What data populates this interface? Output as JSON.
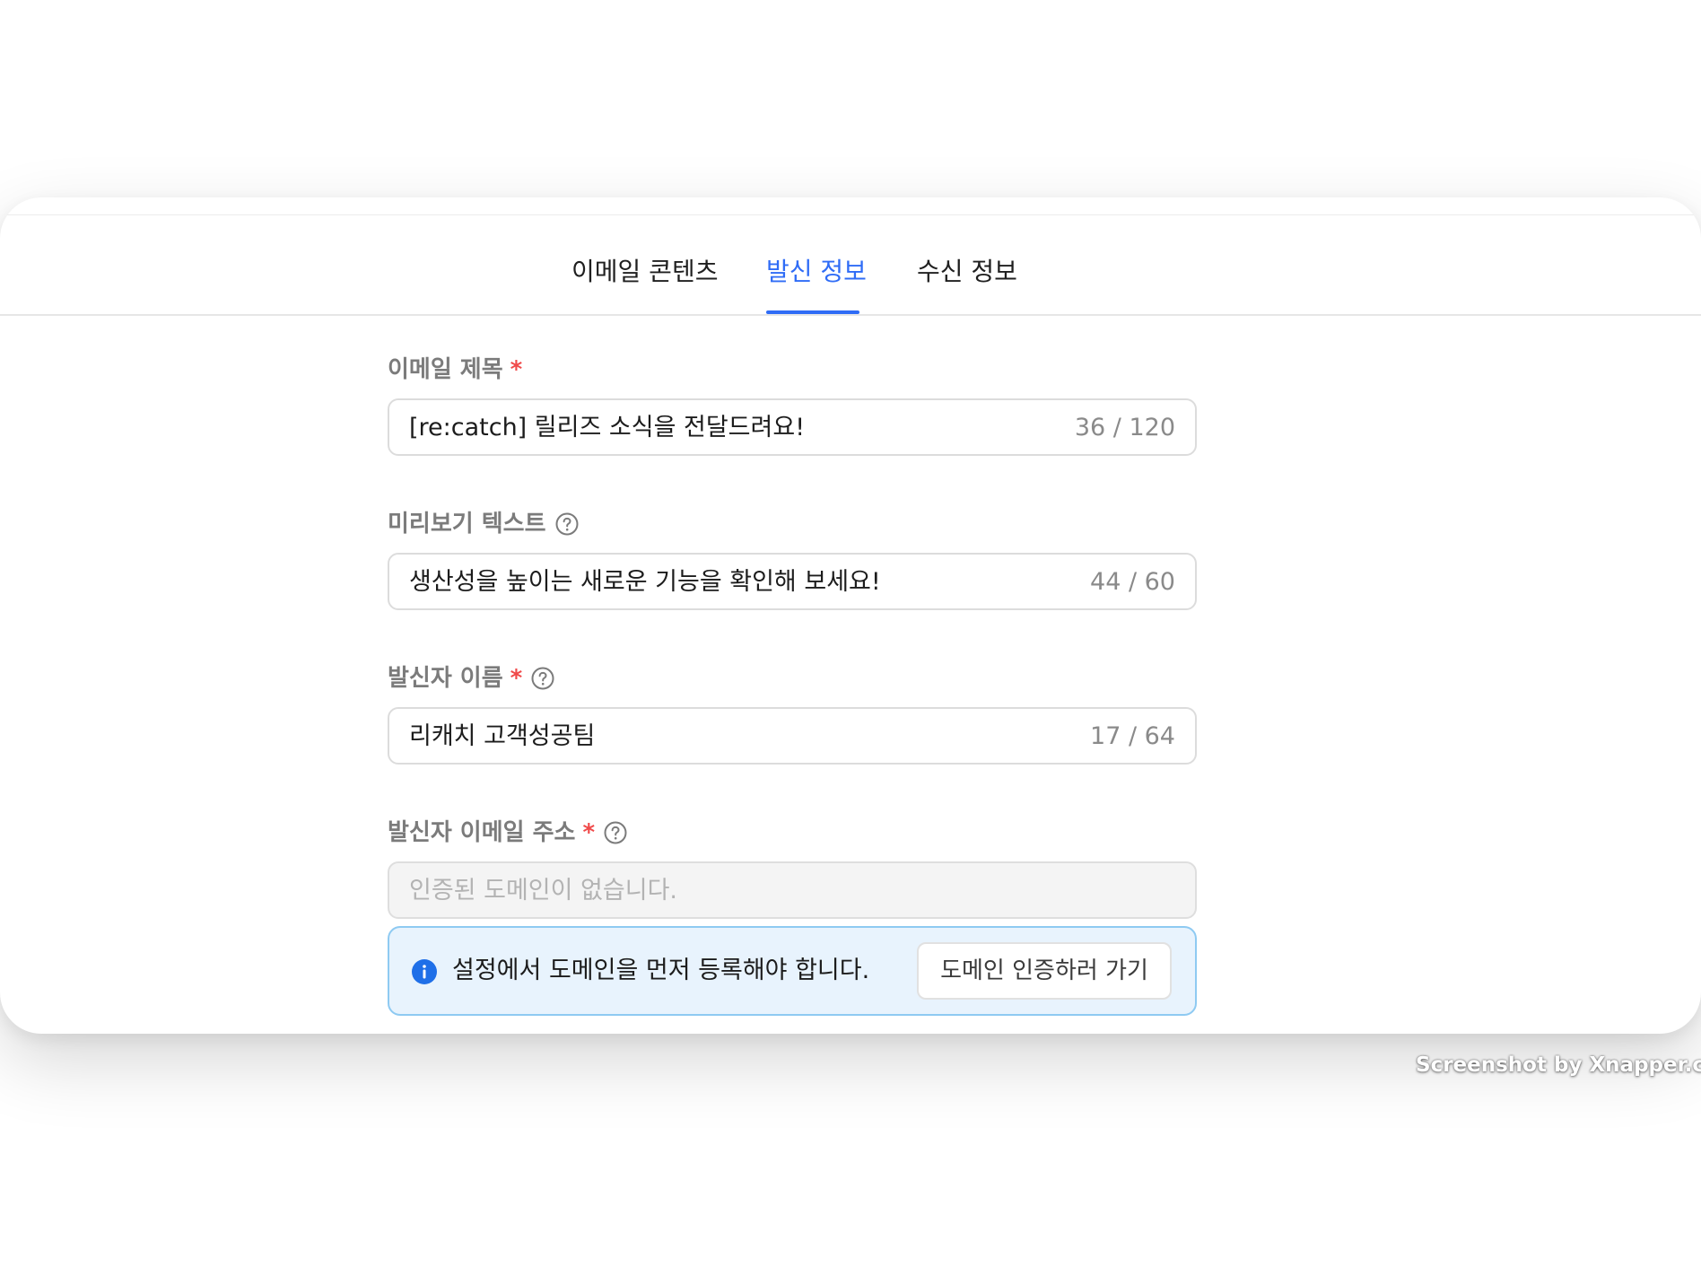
{
  "tabs": [
    {
      "label": "이메일 콘텐츠"
    },
    {
      "label": "발신 정보"
    },
    {
      "label": "수신 정보"
    }
  ],
  "active_tab": "발신 정보",
  "accent_color": "#2f6cf6",
  "required_color": "#f04a4a",
  "form": {
    "subject": {
      "label": "이메일 제목",
      "required_mark": "*",
      "value": "[re:catch] 릴리즈 소식을 전달드려요!",
      "counter": "36 / 120"
    },
    "preview": {
      "label": "미리보기 텍스트",
      "value": "생산성을 높이는 새로운 기능을 확인해 보세요!",
      "counter": "44 / 60"
    },
    "sender_name": {
      "label": "발신자 이름",
      "required_mark": "*",
      "value": "리캐치 고객성공팀",
      "counter": "17 / 64"
    },
    "sender_email": {
      "label": "발신자 이메일 주소",
      "required_mark": "*",
      "placeholder": "인증된 도메인이 없습니다."
    }
  },
  "notice": {
    "icon": "info-icon",
    "text": "설정에서 도메인을 먼저 등록해야 합니다.",
    "button_label": "도메인 인증하러 가기"
  },
  "watermark": "Screenshot by Xnapper.com"
}
